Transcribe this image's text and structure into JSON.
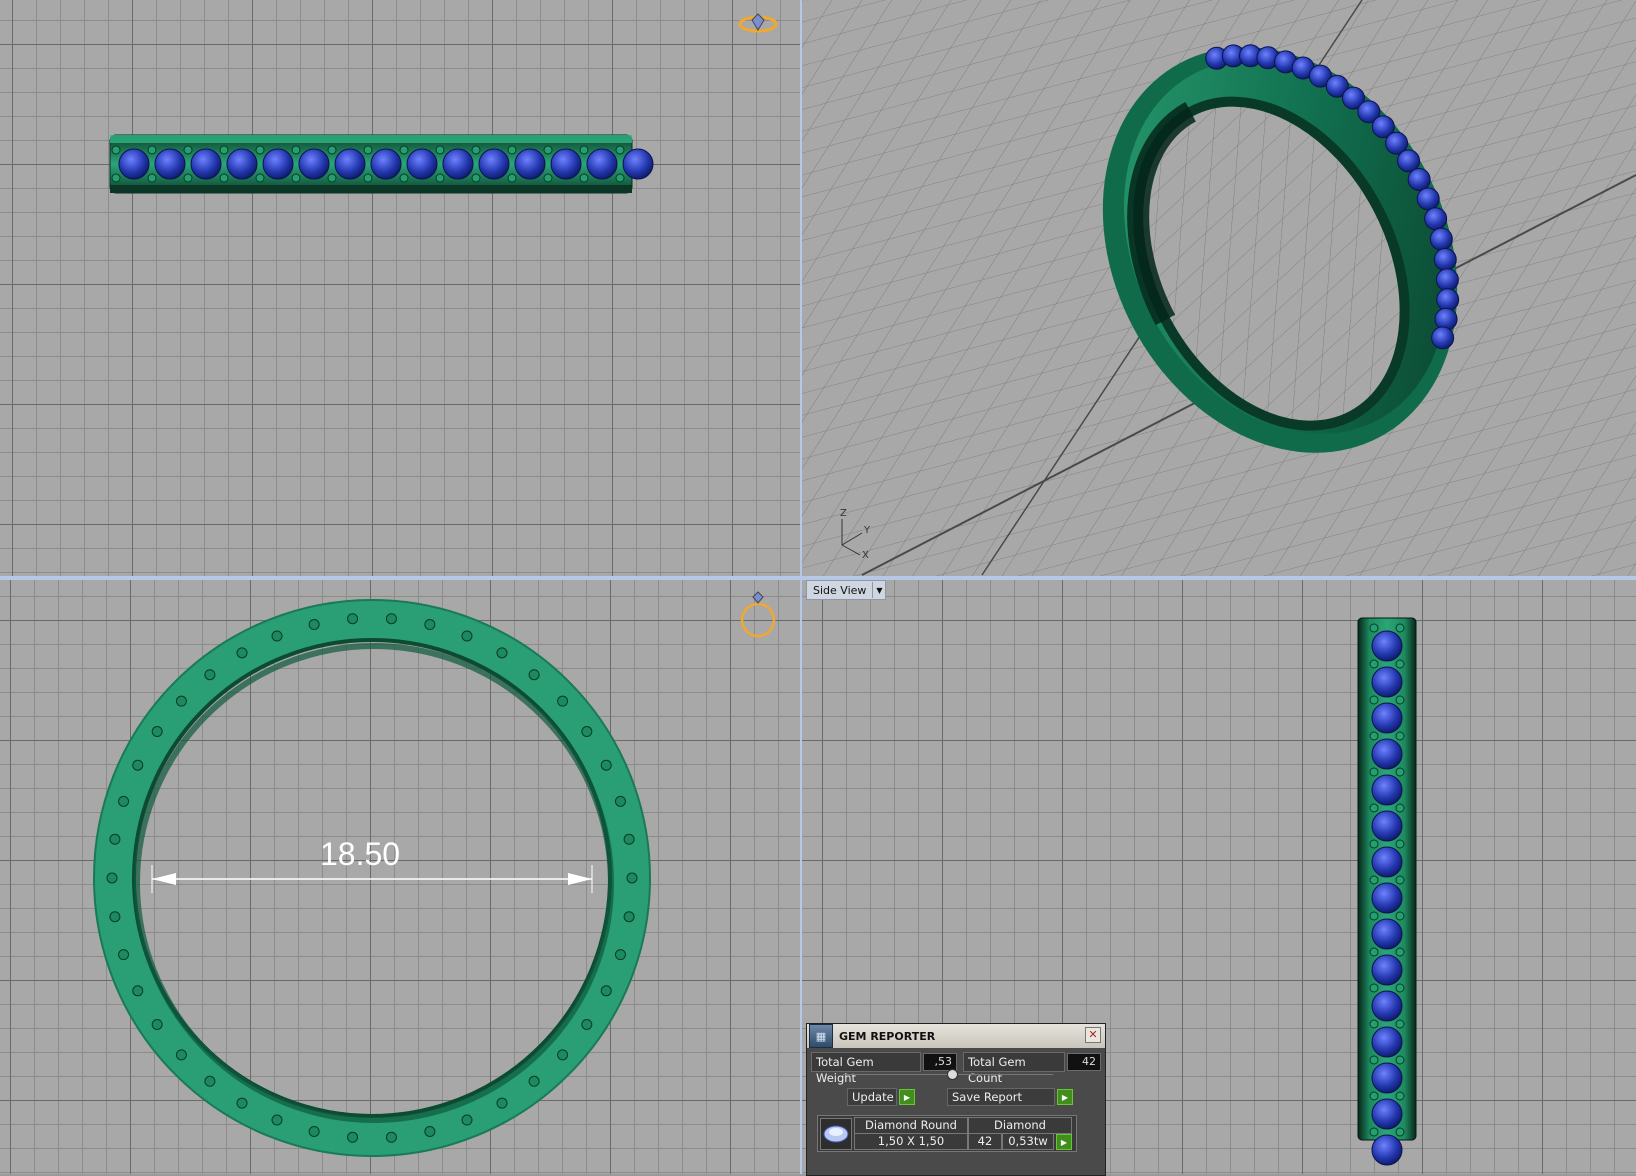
{
  "viewports": {
    "top_left": "top-view",
    "top_right": "perspective-view",
    "bottom_left": "front-view",
    "bottom_right": "side-view"
  },
  "side_view_label": "Side View",
  "dimension": "18.50",
  "axis_labels": {
    "z": "Z",
    "y": "Y",
    "x": "X"
  },
  "gem_reporter": {
    "title": "GEM REPORTER",
    "total_gem_weight_label": "Total Gem Weight",
    "total_gem_weight_value": ",53",
    "total_gem_count_label": "Total Gem Count",
    "total_gem_count_value": "42",
    "update_label": "Update",
    "save_report_label": "Save Report",
    "gem_row": {
      "shape": "Diamond Round",
      "material": "Diamond",
      "size": "1,50 X 1,50",
      "count": "42",
      "weight": "0,53tw"
    }
  },
  "colors": {
    "ring_green": "#1e8f62",
    "ring_dark": "#0f5a3c",
    "gem_blue": "#2438b0",
    "grid_bg": "#a8a8a8",
    "icon_orange": "#f0a830"
  },
  "icons": [
    "ring-top-orientation-icon",
    "ring-front-orientation-icon",
    "gem-reporter-icon",
    "close-icon",
    "dropdown-arrow-icon",
    "go-arrow-icon"
  ]
}
